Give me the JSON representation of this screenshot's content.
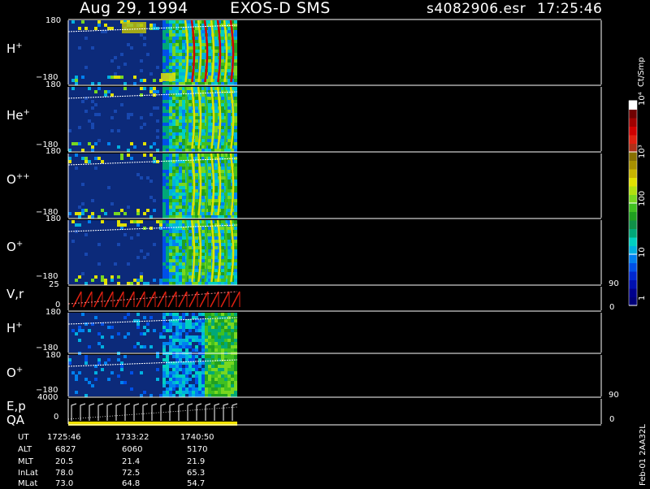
{
  "header": {
    "date": "Aug 29, 1994",
    "mission": "EXOS-D SMS",
    "file": "s4082906.esr",
    "time": "17:25:46"
  },
  "panels": [
    {
      "id": "h1",
      "species": "H",
      "charge": "+",
      "top_tick": "180",
      "bottom_tick": "−180"
    },
    {
      "id": "he",
      "species": "He",
      "charge": "+",
      "top_tick": "180",
      "bottom_tick": "−180"
    },
    {
      "id": "o2",
      "species": "O",
      "charge": "++",
      "top_tick": "180",
      "bottom_tick": "−180"
    },
    {
      "id": "o1",
      "species": "O",
      "charge": "+",
      "top_tick": "180",
      "bottom_tick": "−180"
    },
    {
      "id": "vr",
      "label": "V,r",
      "top_tick": "25",
      "bottom_tick": "0",
      "right_top": "90",
      "right_bottom": "0"
    },
    {
      "id": "h2",
      "species": "H",
      "charge": "+",
      "top_tick": "180",
      "bottom_tick": "−180"
    },
    {
      "id": "o3",
      "species": "O",
      "charge": "+",
      "top_tick": "180",
      "bottom_tick": "−180"
    },
    {
      "id": "ep",
      "label": "E,p",
      "label2": "QA",
      "top_tick": "4000",
      "bottom_tick": "0",
      "right_top": "90",
      "right_bottom": "0"
    }
  ],
  "colorbar": {
    "unit": "Ct/Smp",
    "ticks": [
      {
        "label": "1",
        "value": 1
      },
      {
        "label": "10",
        "value": 10
      },
      {
        "label": "100",
        "value": 100
      },
      {
        "label": "10³",
        "value": 1000
      },
      {
        "label": "10⁴",
        "value": 10000
      }
    ],
    "colors": [
      "#000078",
      "#00008c",
      "#0010b0",
      "#0028d0",
      "#0050e8",
      "#0080f0",
      "#00b0e0",
      "#00d0c0",
      "#00a878",
      "#109048",
      "#20a020",
      "#40c020",
      "#78d820",
      "#b0e010",
      "#e0e000",
      "#c8b400",
      "#a89000",
      "#887000",
      "#b03018",
      "#e02010",
      "#d00000",
      "#a00000",
      "#700000",
      "#ffffff"
    ]
  },
  "footer": {
    "rows": [
      {
        "label": "UT",
        "values": [
          "1725:46",
          "1733:22",
          "1740:50"
        ]
      },
      {
        "label": "ALT",
        "values": [
          "6827",
          "6060",
          "5170"
        ]
      },
      {
        "label": "MLT",
        "values": [
          "20.5",
          "21.4",
          "21.9"
        ]
      },
      {
        "label": "InLat",
        "values": [
          "78.0",
          "72.5",
          "65.3"
        ]
      },
      {
        "label": "MLat",
        "values": [
          "73.0",
          "64.8",
          "54.7"
        ]
      }
    ],
    "stamp": "Feb-01 2AA32L"
  },
  "chart_data": {
    "type": "heatmap",
    "x_ticks_ut": [
      "1725:46",
      "1733:22",
      "1740:50"
    ],
    "y_range_pitch_angle": [
      -180,
      180
    ],
    "color_scale": "log",
    "color_range": [
      1,
      10000
    ],
    "color_unit": "Ct/Smp",
    "series": [
      {
        "name": "H+"
      },
      {
        "name": "He+"
      },
      {
        "name": "O++"
      },
      {
        "name": "O+"
      },
      {
        "name": "V,r"
      },
      {
        "name": "H+"
      },
      {
        "name": "O+"
      },
      {
        "name": "E,p"
      }
    ]
  }
}
